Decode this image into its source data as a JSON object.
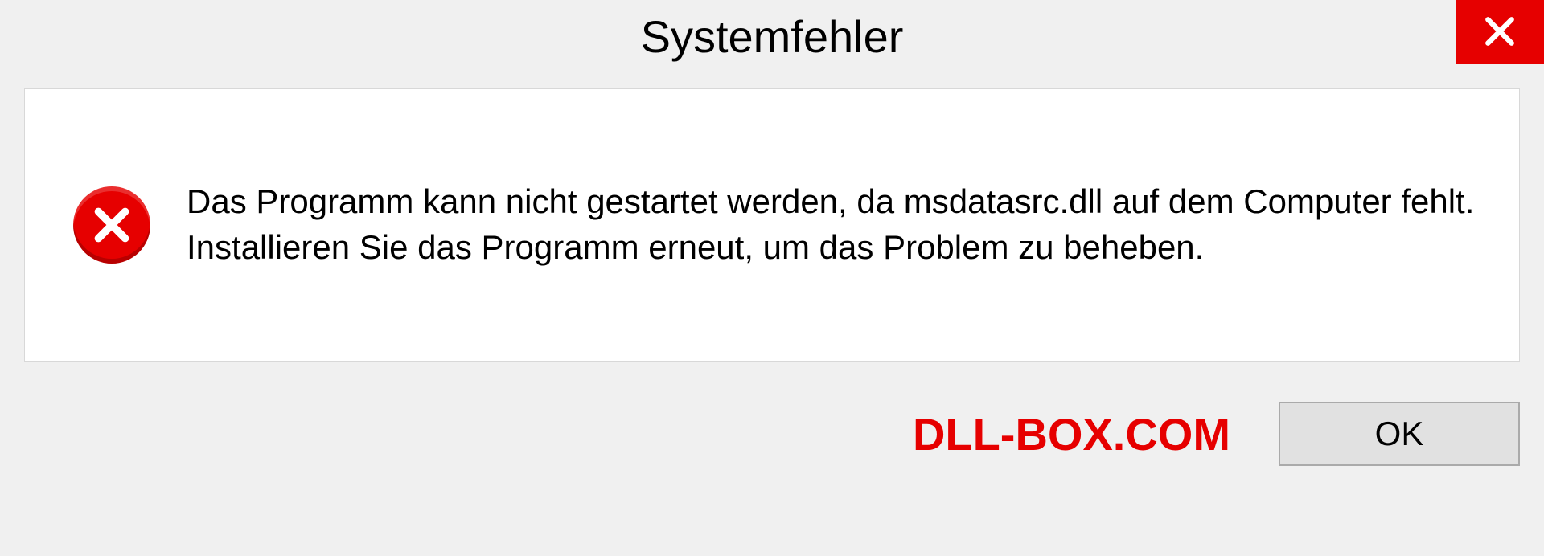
{
  "dialog": {
    "title": "Systemfehler",
    "message": "Das Programm kann nicht gestartet werden, da msdatasrc.dll auf dem Computer fehlt. Installieren Sie das Programm erneut, um das Problem zu beheben.",
    "ok_label": "OK"
  },
  "watermark": "DLL-BOX.COM"
}
